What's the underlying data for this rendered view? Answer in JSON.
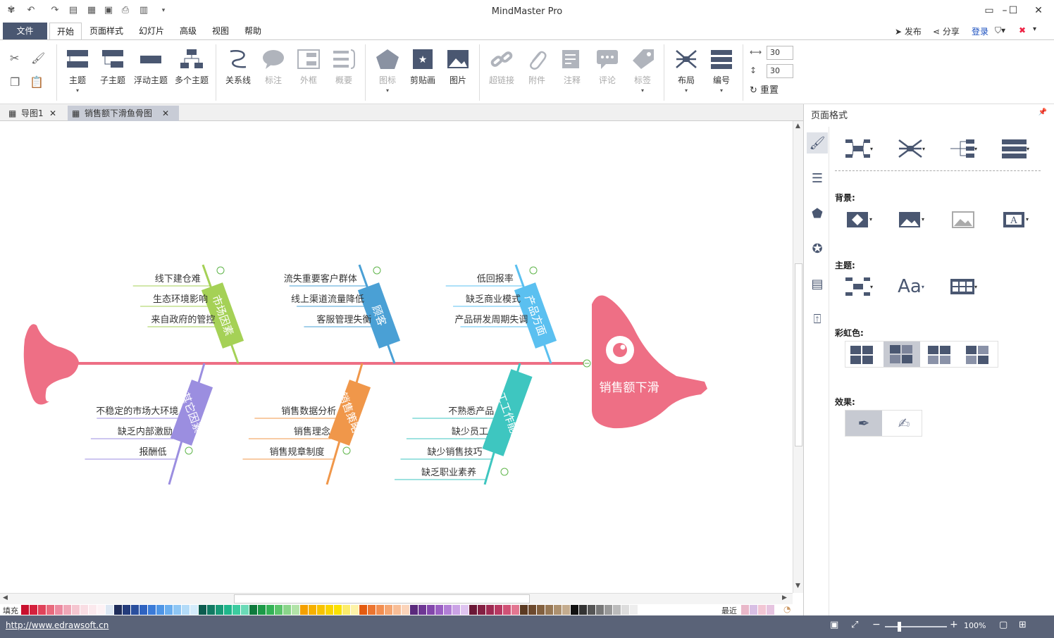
{
  "window": {
    "title": "MindMaster Pro"
  },
  "menu": {
    "file": "文件",
    "items": [
      "开始",
      "页面样式",
      "幻灯片",
      "高级",
      "视图",
      "帮助"
    ],
    "publish": "发布",
    "share": "分享",
    "login": "登录"
  },
  "ribbon": {
    "topic": "主题",
    "subtopic": "子主题",
    "float_topic": "浮动主题",
    "multi_topic": "多个主题",
    "relation": "关系线",
    "callout": "标注",
    "boundary": "外框",
    "summary": "概要",
    "icon": "图标",
    "clipart": "剪贴画",
    "image": "图片",
    "hyperlink": "超链接",
    "attachment": "附件",
    "note": "注释",
    "comment": "评论",
    "tag": "标签",
    "layout": "布局",
    "numbering": "编号",
    "spacing_h": "30",
    "spacing_v": "30",
    "reset": "重置"
  },
  "tabs": [
    "导图1",
    "销售额下滑鱼骨图"
  ],
  "fishbone": {
    "head": "销售额下滑",
    "top_branches": [
      {
        "label": "市场因素",
        "color": "#a5d156",
        "causes": [
          "线下建仓难",
          "生态环境影响",
          "来自政府的管控"
        ]
      },
      {
        "label": "顾客",
        "color": "#4aa0d5",
        "causes": [
          "流失重要客户群体",
          "线上渠道流量降低",
          "客服管理失衡"
        ]
      },
      {
        "label": "产品方面",
        "color": "#5bc0f0",
        "causes": [
          "低回报率",
          "缺乏商业模式",
          "产品研发周期失调"
        ]
      }
    ],
    "bottom_branches": [
      {
        "label": "其它因素",
        "color": "#9b8ee0",
        "causes": [
          "不稳定的市场大环境",
          "缺乏内部激励",
          "报酬低"
        ]
      },
      {
        "label": "销售策略",
        "color": "#f0974a",
        "causes": [
          "销售数据分析",
          "销售理念",
          "销售规章制度"
        ]
      },
      {
        "label": "员工工作能力",
        "color": "#3ec6c0",
        "causes": [
          "不熟悉产品",
          "缺少员工",
          "缺少销售技巧",
          "缺乏职业素养"
        ]
      }
    ],
    "spine_color": "#ee6f85"
  },
  "palette": {
    "fill_label": "填充",
    "recent_label": "最近"
  },
  "status": {
    "url": "http://www.edrawsoft.cn",
    "zoom": "100%"
  },
  "sidepanel": {
    "title": "页面格式",
    "background": "背景:",
    "theme": "主题:",
    "rainbow": "彩虹色:",
    "effect": "效果:"
  }
}
